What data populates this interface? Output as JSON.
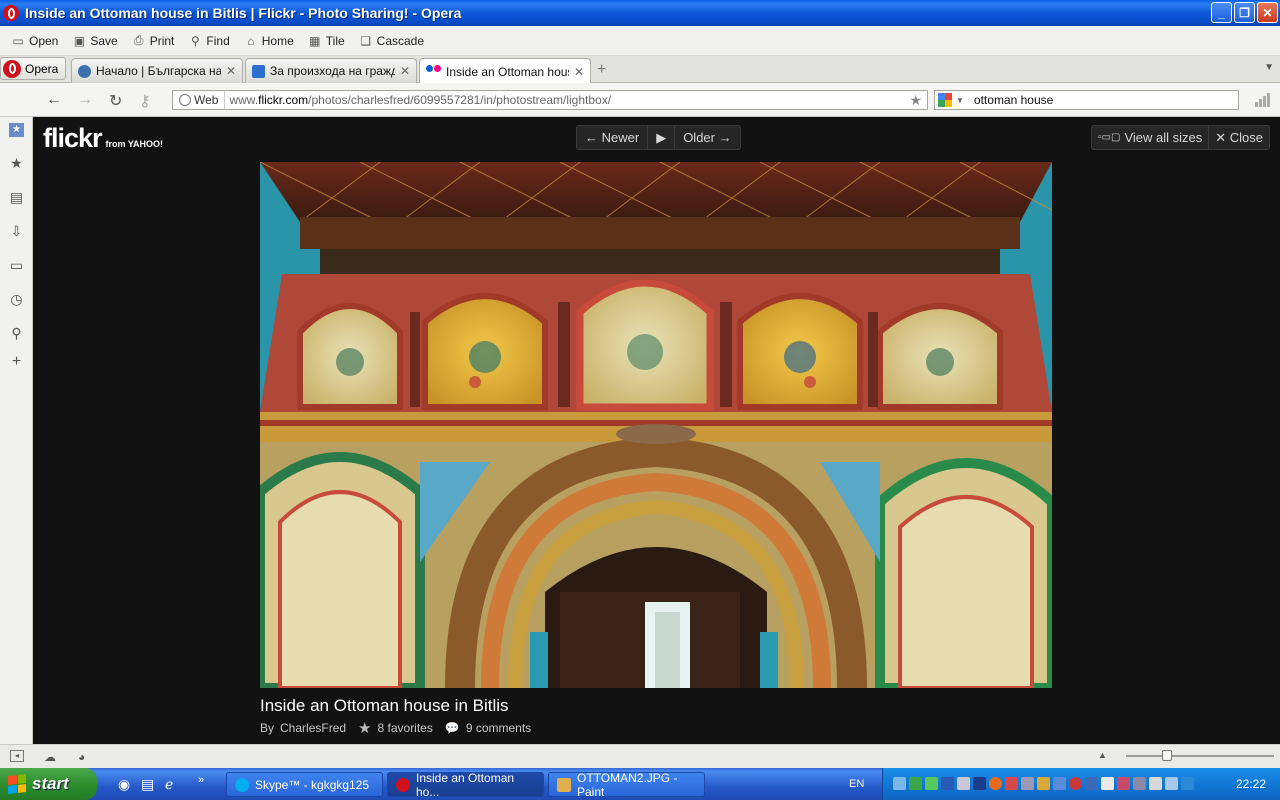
{
  "window": {
    "title": "Inside an Ottoman house in Bitlis | Flickr - Photo Sharing! - Opera",
    "buttons": {
      "minimize": "_",
      "maximize": "❐",
      "close": "✕"
    }
  },
  "toolbar": {
    "items": [
      {
        "label": "Open",
        "icon": "open-icon"
      },
      {
        "label": "Save",
        "icon": "save-icon"
      },
      {
        "label": "Print",
        "icon": "print-icon"
      },
      {
        "label": "Find",
        "icon": "find-icon"
      },
      {
        "label": "Home",
        "icon": "home-icon"
      },
      {
        "label": "Tile",
        "icon": "tile-icon"
      },
      {
        "label": "Cascade",
        "icon": "cascade-icon"
      }
    ]
  },
  "tabs": {
    "menu_label": "Opera",
    "items": [
      {
        "label": "Начало | Българска на...",
        "favicon_color": "#3b6fb0",
        "active": false
      },
      {
        "label": "За произхода на гражд...",
        "favicon_color": "#2d6fd0",
        "active": false
      },
      {
        "label": "Inside an Ottoman hous...",
        "favicon_color": "#ff0084",
        "active": true
      }
    ],
    "new_tab": "+"
  },
  "address": {
    "mode_label": "Web",
    "url_prefix": "www.",
    "url_domain": "flickr.com",
    "url_path": "/photos/charlesfred/6099557281/in/photostream/lightbox/",
    "search_value": "ottoman house"
  },
  "flickr": {
    "logo_text": "flickr",
    "logo_sub": "from YAHOO!",
    "pager": {
      "newer": "← Newer",
      "play": "▶",
      "older": "Older →"
    },
    "view_all_sizes": "View all sizes",
    "close": "✕ Close",
    "photo_title": "Inside an Ottoman house in Bitlis",
    "by_prefix": "By",
    "author": "CharlesFred",
    "favorites": "8 favorites",
    "comments": "9 comments"
  },
  "taskbar": {
    "start_label": "start",
    "tasks": [
      {
        "label": "Skype™ - kgkgkg125",
        "icon_color": "#00aff0",
        "active": false
      },
      {
        "label": "Inside an Ottoman ho...",
        "icon_color": "#d0101c",
        "active": true
      },
      {
        "label": "OTTOMAN2.JPG - Paint",
        "icon_color": "#e0b050",
        "active": false
      }
    ],
    "language": "EN",
    "clock": "22:22"
  },
  "colors": {
    "titlebar": "#0a58d8",
    "flickr_bg": "#121212",
    "taskbar": "#2558c8",
    "start_green": "#2f8f2f"
  }
}
